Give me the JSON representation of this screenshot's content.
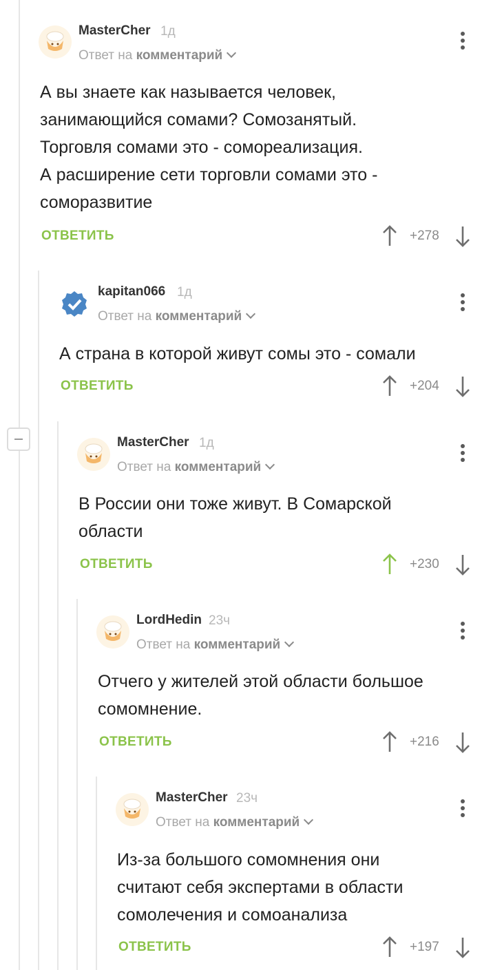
{
  "colors": {
    "accent_green": "#8bc34a",
    "muted": "#a8a8a8",
    "text": "#222222",
    "verified_blue": "#4a86c5"
  },
  "comments": [
    {
      "author": "MasterCher",
      "time": "1д",
      "reply_prefix": "Ответ на",
      "reply_target": "комментарий",
      "avatar_icon": "chef-hat-avatar",
      "lines": [
        "А вы знаете как называется человек,",
        "занимающийся сомами? Сомозанятый.",
        "Торговля сомами это - сомореализация.",
        "А расширение сети торговли сомами это -",
        "соморазвитие"
      ],
      "reply_label": "ОТВЕТИТЬ",
      "score": "+278",
      "upvoted": false
    },
    {
      "author": "kapitan066",
      "time": "1д",
      "reply_prefix": "Ответ на",
      "reply_target": "комментарий",
      "avatar_icon": "verified-badge-avatar",
      "lines": [
        "А страна в которой живут сомы это - сомали"
      ],
      "reply_label": "ОТВЕТИТЬ",
      "score": "+204",
      "upvoted": false
    },
    {
      "author": "MasterCher",
      "time": "1д",
      "reply_prefix": "Ответ на",
      "reply_target": "комментарий",
      "avatar_icon": "chef-hat-avatar",
      "lines": [
        "В России они тоже живут. В Сомарской",
        "области"
      ],
      "reply_label": "ОТВЕТИТЬ",
      "score": "+230",
      "upvoted": true
    },
    {
      "author": "LordHedin",
      "time": "23ч",
      "reply_prefix": "Ответ на",
      "reply_target": "комментарий",
      "avatar_icon": "chef-hat-avatar",
      "lines": [
        "Отчего у жителей этой области большое",
        "сомомнение."
      ],
      "reply_label": "ОТВЕТИТЬ",
      "score": "+216",
      "upvoted": false
    },
    {
      "author": "MasterCher",
      "time": "23ч",
      "reply_prefix": "Ответ на",
      "reply_target": "комментарий",
      "avatar_icon": "chef-hat-avatar",
      "lines": [
        "Из-за большого сомомнения они",
        "считают себя экспертами в области",
        "сомолечения и сомоанализа"
      ],
      "reply_label": "ОТВЕТИТЬ",
      "score": "+197",
      "upvoted": false
    }
  ]
}
